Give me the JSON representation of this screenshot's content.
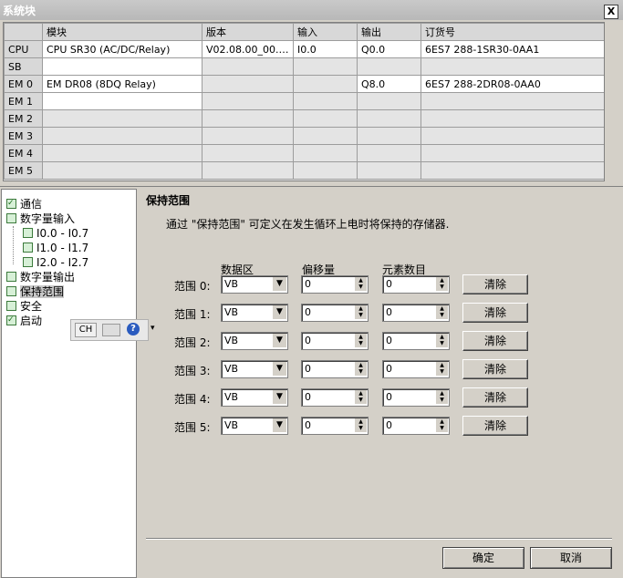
{
  "window": {
    "title": "系统块",
    "close_label": "X"
  },
  "table": {
    "headers": [
      "",
      "模块",
      "版本",
      "输入",
      "输出",
      "订货号"
    ],
    "rows": [
      {
        "slot": "CPU",
        "module": "CPU SR30 (AC/DC/Relay)",
        "version": "V02.08.00_00.00...",
        "input": "I0.0",
        "output": "Q0.0",
        "order": "6ES7 288-1SR30-0AA1"
      },
      {
        "slot": "SB",
        "module": "",
        "version": "",
        "input": "",
        "output": "",
        "order": ""
      },
      {
        "slot": "EM 0",
        "module": "EM DR08 (8DQ Relay)",
        "version": "",
        "input": "",
        "output": "Q8.0",
        "order": "6ES7 288-2DR08-0AA0"
      },
      {
        "slot": "EM 1",
        "module": "",
        "version": "",
        "input": "",
        "output": "",
        "order": ""
      },
      {
        "slot": "EM 2",
        "module": "",
        "version": "",
        "input": "",
        "output": "",
        "order": ""
      },
      {
        "slot": "EM 3",
        "module": "",
        "version": "",
        "input": "",
        "output": "",
        "order": ""
      },
      {
        "slot": "EM 4",
        "module": "",
        "version": "",
        "input": "",
        "output": "",
        "order": ""
      },
      {
        "slot": "EM 5",
        "module": "",
        "version": "",
        "input": "",
        "output": "",
        "order": ""
      }
    ]
  },
  "tree": {
    "items": [
      "通信",
      "数字量输入",
      "I0.0 - I0.7",
      "I1.0 - I1.7",
      "I2.0 - I2.7",
      "数字量输出",
      "保持范围",
      "安全",
      "启动"
    ]
  },
  "ime": {
    "ch_label": "CH",
    "help_label": "?"
  },
  "panel": {
    "title": "保持范围",
    "description": "通过 \"保持范围\" 可定义在发生循环上电时将保持的存储器.",
    "col_data_area": "数据区",
    "col_offset": "偏移量",
    "col_count": "元素数目",
    "ranges": [
      {
        "label": "范围 0:",
        "area": "VB",
        "offset": "0",
        "count": "0",
        "clear": "清除"
      },
      {
        "label": "范围 1:",
        "area": "VB",
        "offset": "0",
        "count": "0",
        "clear": "清除"
      },
      {
        "label": "范围 2:",
        "area": "VB",
        "offset": "0",
        "count": "0",
        "clear": "清除"
      },
      {
        "label": "范围 3:",
        "area": "VB",
        "offset": "0",
        "count": "0",
        "clear": "清除"
      },
      {
        "label": "范围 4:",
        "area": "VB",
        "offset": "0",
        "count": "0",
        "clear": "清除"
      },
      {
        "label": "范围 5:",
        "area": "VB",
        "offset": "0",
        "count": "0",
        "clear": "清除"
      }
    ]
  },
  "footer": {
    "ok_label": "确定",
    "cancel_label": "取消"
  }
}
